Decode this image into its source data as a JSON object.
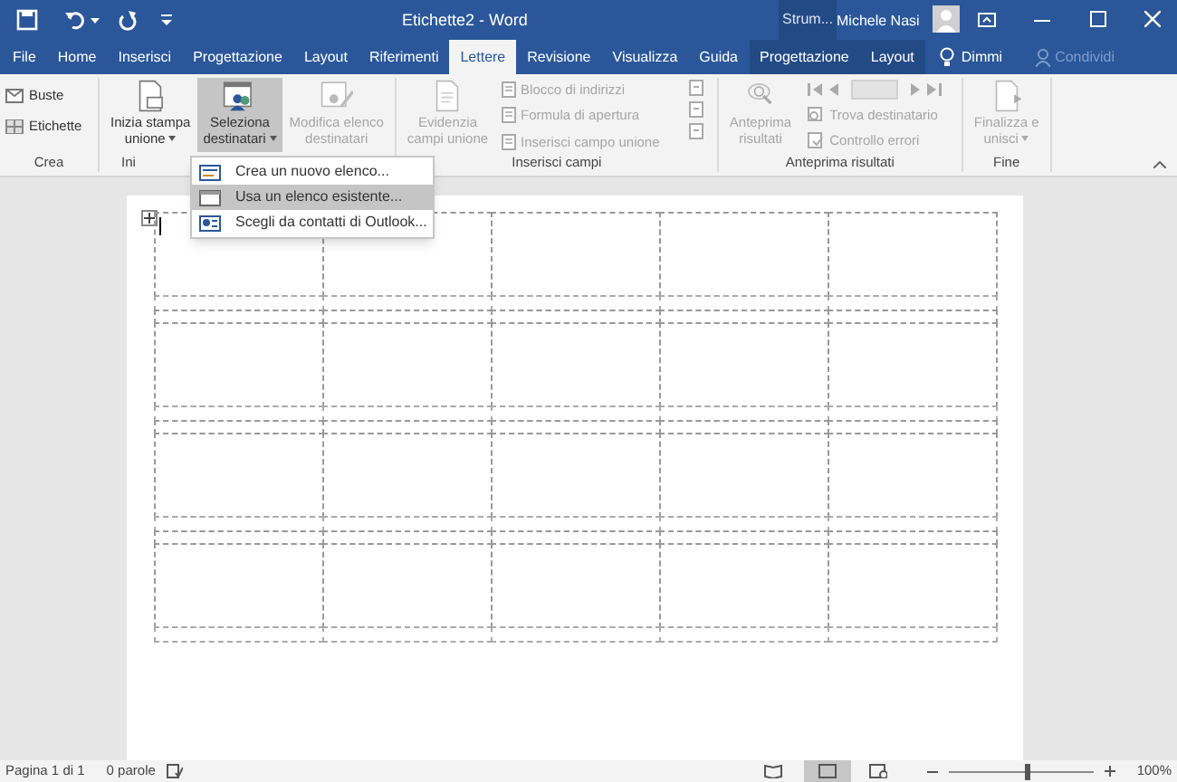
{
  "window": {
    "title": "Etichette2 - Word",
    "context_label": "Strum...",
    "user": "Michele Nasi"
  },
  "tabs": [
    {
      "label": "File",
      "selected": false,
      "kind": "normal"
    },
    {
      "label": "Home",
      "selected": false,
      "kind": "normal"
    },
    {
      "label": "Inserisci",
      "selected": false,
      "kind": "normal"
    },
    {
      "label": "Progettazione",
      "selected": false,
      "kind": "normal"
    },
    {
      "label": "Layout",
      "selected": false,
      "kind": "normal"
    },
    {
      "label": "Riferimenti",
      "selected": false,
      "kind": "normal"
    },
    {
      "label": "Lettere",
      "selected": true,
      "kind": "normal"
    },
    {
      "label": "Revisione",
      "selected": false,
      "kind": "normal"
    },
    {
      "label": "Visualizza",
      "selected": false,
      "kind": "normal"
    },
    {
      "label": "Guida",
      "selected": false,
      "kind": "normal"
    },
    {
      "label": "Progettazione",
      "selected": false,
      "kind": "contextual"
    },
    {
      "label": "Layout",
      "selected": false,
      "kind": "contextual"
    }
  ],
  "tell_me": "Dimmi",
  "share": {
    "label": "Condividi",
    "disabled": true
  },
  "ribbon": {
    "crea": {
      "label": "Crea",
      "items": [
        {
          "label": "Buste"
        },
        {
          "label": "Etichette"
        }
      ]
    },
    "inizia": {
      "label": "Ini",
      "buttons": [
        {
          "lines": [
            "Inizia stampa",
            "unione"
          ],
          "dropdown": true,
          "disabled": false,
          "selected": false
        },
        {
          "lines": [
            "Seleziona",
            "destinatari"
          ],
          "dropdown": true,
          "disabled": false,
          "selected": true
        },
        {
          "lines": [
            "Modifica elenco",
            "destinatari"
          ],
          "dropdown": false,
          "disabled": true,
          "selected": false
        }
      ]
    },
    "inserisci": {
      "label": "Inserisci campi",
      "big": {
        "lines": [
          "Evidenzia",
          "campi unione"
        ],
        "disabled": true
      },
      "items": [
        {
          "label": "Blocco di indirizzi",
          "disabled": true
        },
        {
          "label": "Formula di apertura",
          "disabled": true
        },
        {
          "label": "Inserisci campo unione",
          "disabled": true
        }
      ]
    },
    "anteprima": {
      "label": "Anteprima risultati",
      "big": {
        "lines": [
          "Anteprima",
          "risultati"
        ],
        "disabled": true
      },
      "items": [
        {
          "label": "Trova destinatario",
          "disabled": true
        },
        {
          "label": "Controllo errori",
          "disabled": true
        }
      ]
    },
    "fine": {
      "label": "Fine",
      "big": {
        "lines": [
          "Finalizza e",
          "unisci"
        ],
        "dropdown": true,
        "disabled": true
      }
    }
  },
  "menu": [
    {
      "label": "Crea un nuovo elenco...",
      "selected": false
    },
    {
      "label": "Usa un elenco esistente...",
      "selected": true
    },
    {
      "label": "Scegli da contatti di Outlook...",
      "selected": false
    }
  ],
  "status_bar": {
    "page": "Pagina 1 di 1",
    "words": "0 parole",
    "zoom": "100%",
    "zoom_slider": {
      "level": 0.55
    }
  }
}
